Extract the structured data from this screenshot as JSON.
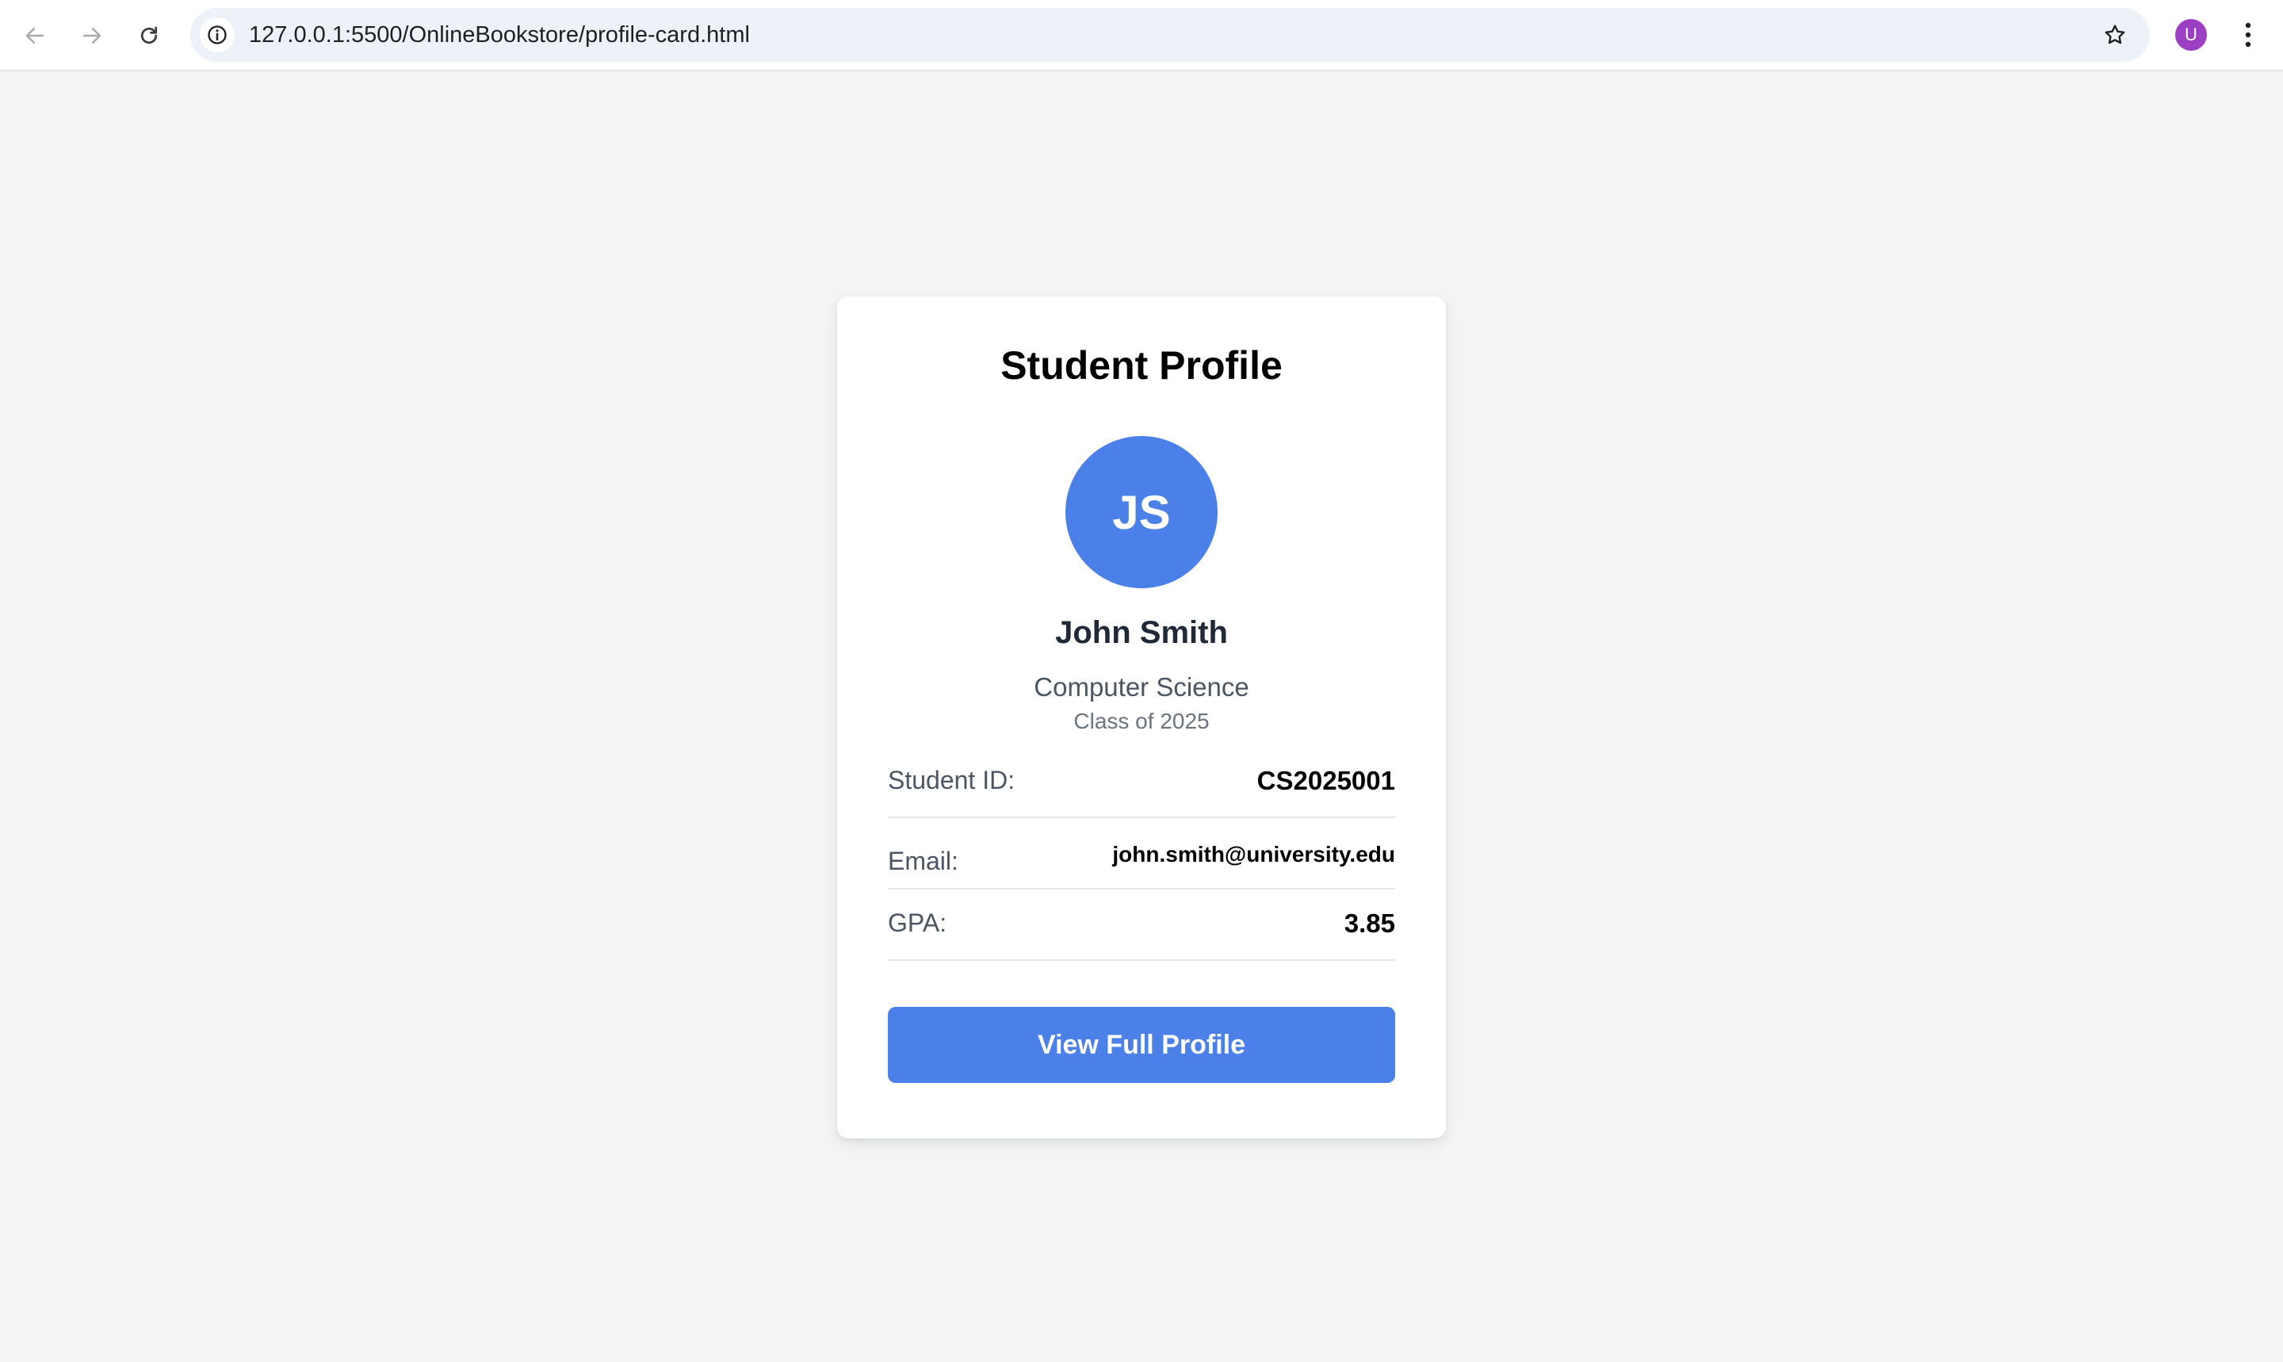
{
  "browser": {
    "url": "127.0.0.1:5500/OnlineBookstore/profile-card.html",
    "profile_initial": "U",
    "profile_color": "#9c3fc2"
  },
  "icons": {
    "back": "arrow-left-icon",
    "forward": "arrow-right-icon",
    "reload": "reload-icon",
    "site_info": "info-icon",
    "bookmark": "star-icon",
    "menu": "kebab-menu-icon"
  },
  "card": {
    "title": "Student Profile",
    "avatar_initials": "JS",
    "name": "John Smith",
    "major": "Computer Science",
    "class_year": "Class of 2025",
    "fields": [
      {
        "label": "Student ID:",
        "value": "CS2025001"
      },
      {
        "label": "Email:",
        "value": "john.smith@university.edu"
      },
      {
        "label": "GPA:",
        "value": "3.85"
      }
    ],
    "button_label": "View Full Profile"
  },
  "colors": {
    "accent": "#4a80e8",
    "page_background": "#f3f4f6",
    "card_background": "#ffffff"
  }
}
